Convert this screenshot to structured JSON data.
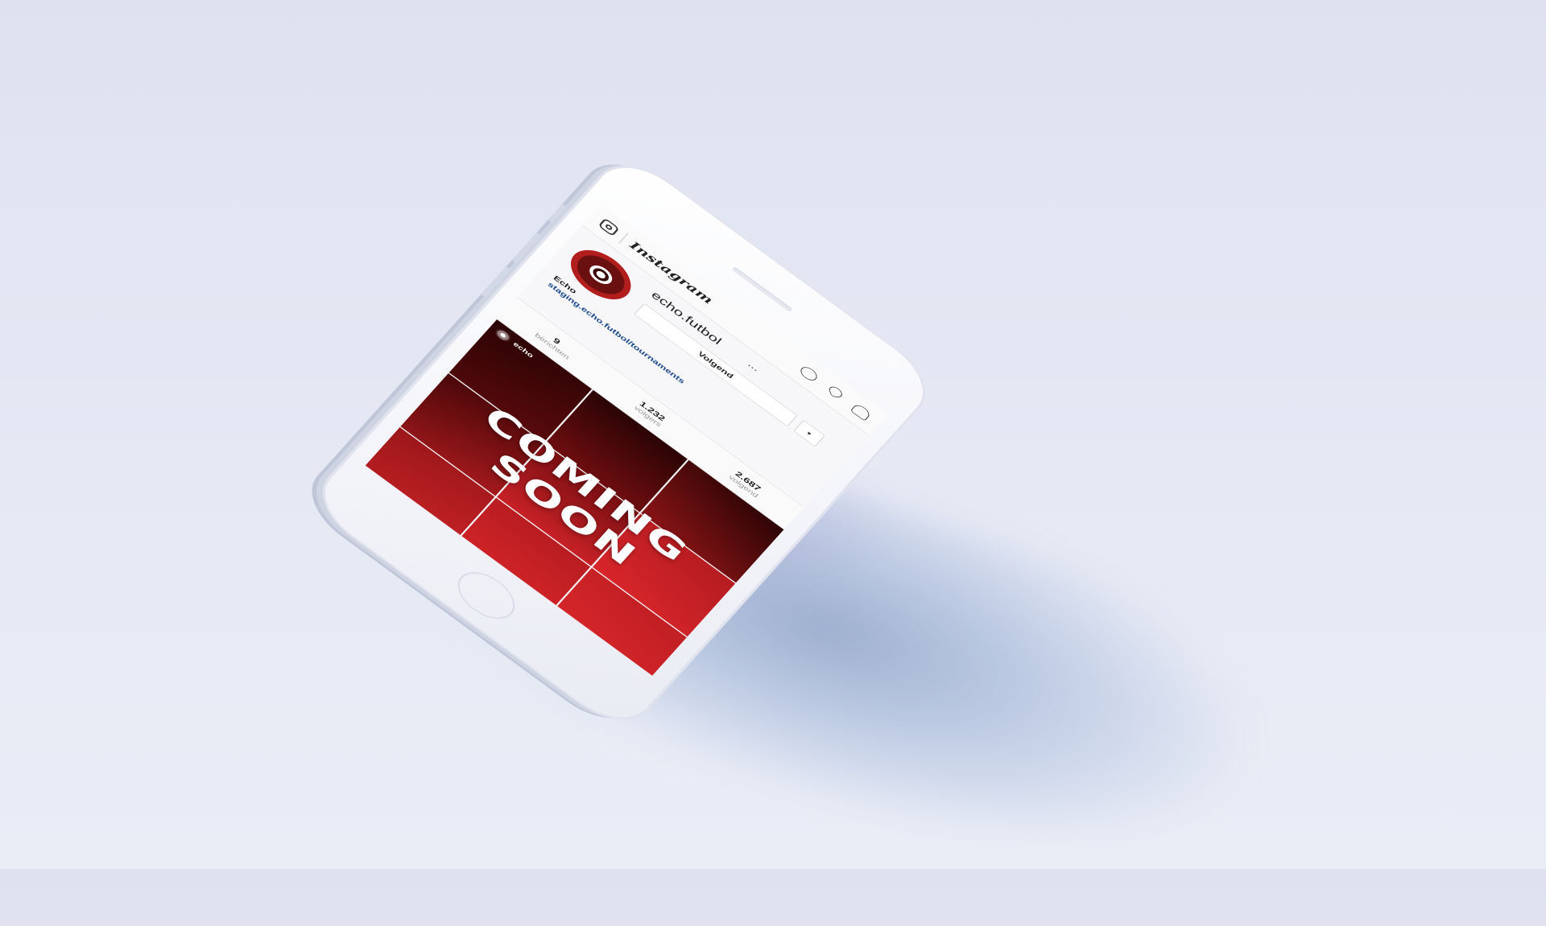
{
  "topbar": {
    "logo": "Instagram",
    "icons": [
      "instagram-camera-icon",
      "compass-icon",
      "heart-icon",
      "user-icon"
    ]
  },
  "profile": {
    "username": "echo.futbol",
    "more": "...",
    "follow_label": "Volgend",
    "dropdown": "▾",
    "name": "Echo",
    "link": "staging.echo.futbol/tournaments"
  },
  "stats": [
    {
      "value": "9",
      "label": "berichten"
    },
    {
      "value": "1.232",
      "label": "volgers"
    },
    {
      "value": "2.687",
      "label": "volgend"
    }
  ],
  "post": {
    "author": "echo",
    "headline_1": "COMING",
    "headline_2": "SOON"
  },
  "colors": {
    "accent_red": "#d52529",
    "dark_red": "#2a0304",
    "link_blue": "#1d4a8c",
    "phone_body": "#f3f4f9"
  }
}
